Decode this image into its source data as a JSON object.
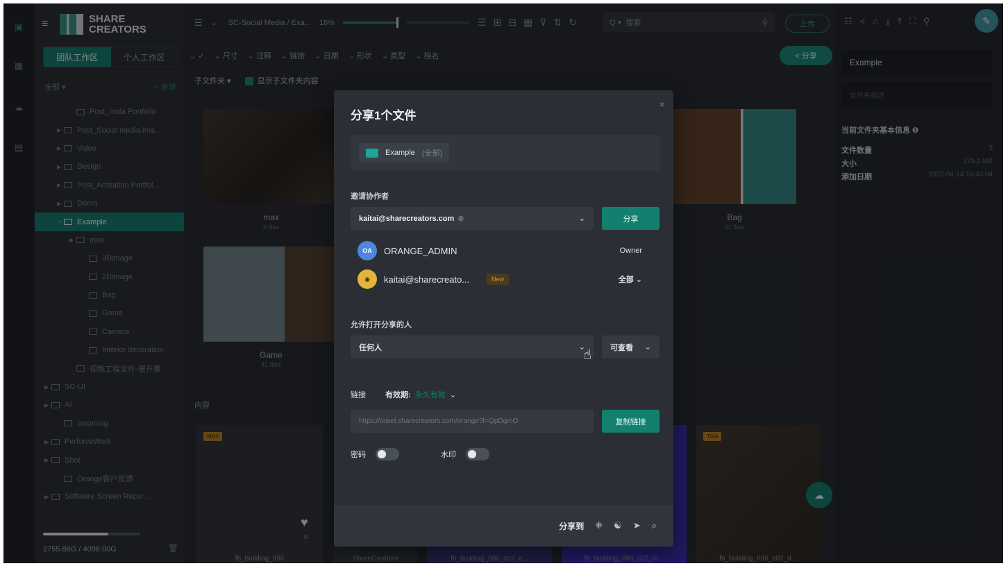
{
  "brand": {
    "line1": "SHARE",
    "line2": "CREATORS"
  },
  "sidebar": {
    "tabs": [
      "团队工作区",
      "个人工作区"
    ],
    "head_left": "全部 ▾",
    "head_right": "+ 新建",
    "tree": [
      {
        "label": "Post_Insta Portfolio",
        "indent": 2,
        "arrow": ""
      },
      {
        "label": "Post_Social media ima...",
        "indent": 1,
        "arrow": "▶"
      },
      {
        "label": "Video",
        "indent": 1,
        "arrow": "▶"
      },
      {
        "label": "Design",
        "indent": 1,
        "arrow": "▶"
      },
      {
        "label": "Post_Artstation Portfol...",
        "indent": 1,
        "arrow": "▶"
      },
      {
        "label": "Demo",
        "indent": 1,
        "arrow": "▶"
      },
      {
        "label": "Example",
        "indent": 1,
        "arrow": "▼",
        "selected": true
      },
      {
        "label": "max",
        "indent": 2,
        "arrow": "▶"
      },
      {
        "label": "3Dimage",
        "indent": 3,
        "arrow": ""
      },
      {
        "label": "2Dimage",
        "indent": 3,
        "arrow": ""
      },
      {
        "label": "Bag",
        "indent": 3,
        "arrow": ""
      },
      {
        "label": "Game",
        "indent": 3,
        "arrow": ""
      },
      {
        "label": "Camera",
        "indent": 3,
        "arrow": ""
      },
      {
        "label": "Interior decoration",
        "indent": 3,
        "arrow": ""
      },
      {
        "label": "视频工程文件-便开事",
        "indent": 2,
        "arrow": ""
      },
      {
        "label": "SC-UI",
        "indent": 0,
        "arrow": "▶"
      },
      {
        "label": "AI",
        "indent": 0,
        "arrow": "▶"
      },
      {
        "label": "Incoming",
        "indent": 1,
        "arrow": ""
      },
      {
        "label": "PerforceWork",
        "indent": 0,
        "arrow": "▶"
      },
      {
        "label": "Shot",
        "indent": 0,
        "arrow": "▶"
      },
      {
        "label": "Orange客户反馈",
        "indent": 1,
        "arrow": ""
      },
      {
        "label": "Software Screen Recor...",
        "indent": 0,
        "arrow": "▶"
      }
    ],
    "storage_text": "2755.86G / 4096.00G",
    "storage_used": 0.67
  },
  "toolbar": {
    "breadcrumb": "SC-Social Media / Exa...",
    "zoom": "16%",
    "search_placeholder": "搜索",
    "search_prefix": "Q ▾",
    "upload_label": "上传"
  },
  "filters": [
    "✓",
    "尺寸",
    "注释",
    "链接",
    "日期",
    "形状",
    "类型",
    "档名"
  ],
  "share_top_label": "< 分享",
  "subbar": {
    "subfolder": "子文件夹 ▾",
    "show_label": "显示子文件夹内容"
  },
  "cards": [
    {
      "title": "max",
      "sub": "3 files"
    },
    {
      "title": "Bag",
      "sub": "61 files"
    },
    {
      "title": "Game",
      "sub": "41 files"
    }
  ],
  "section_label": "内容",
  "bottom_cards": [
    {
      "title": "fb_building_096",
      "badge": "MAX",
      "likes": "0"
    },
    {
      "title": "ShareCreators",
      "badge": ""
    },
    {
      "title": "fb_building_090_c02_e...",
      "badge": ""
    },
    {
      "title": "fb_building_090_c02_m...",
      "badge": ""
    },
    {
      "title": "fb_building_096_c02_d...",
      "badge": "TGA"
    }
  ],
  "rpanel": {
    "name_value": "Example",
    "desc_placeholder": "文件夹描述",
    "info_head": "当前文件夹基本信息 ❶",
    "info": [
      {
        "k": "文件数量",
        "v": "3"
      },
      {
        "k": "大小",
        "v": "270.2 MB"
      },
      {
        "k": "添加日期",
        "v": "2023-04-14 18:40:04"
      }
    ]
  },
  "modal": {
    "title": "分享1个文件",
    "file_name": "Example",
    "file_scope": "(全部)",
    "invite_label": "邀请协作者",
    "invite_email": "kaitai@sharecreators.com",
    "share_btn": "分享",
    "members": [
      {
        "initials": "OA",
        "name": "ORANGE_ADMIN",
        "role": "Owner",
        "tag": "",
        "color": "#4f86d9"
      },
      {
        "initials": "◉",
        "name": "kaitai@sharecreato...",
        "role": "全部  ⌄",
        "tag": "New",
        "color": "#e2b53a"
      }
    ],
    "allow_label": "允许打开分享的人",
    "allow_value": "任何人",
    "perm_value": "可查看",
    "link_label": "链接",
    "validity_label": "有效期:",
    "validity_value": "永久有效",
    "url": "https://cnsel.sharecreators.com/orange?f=QpDgmO",
    "copy_btn": "复制链接",
    "password_label": "密码",
    "watermark_label": "水印",
    "share_to_label": "分享到"
  }
}
